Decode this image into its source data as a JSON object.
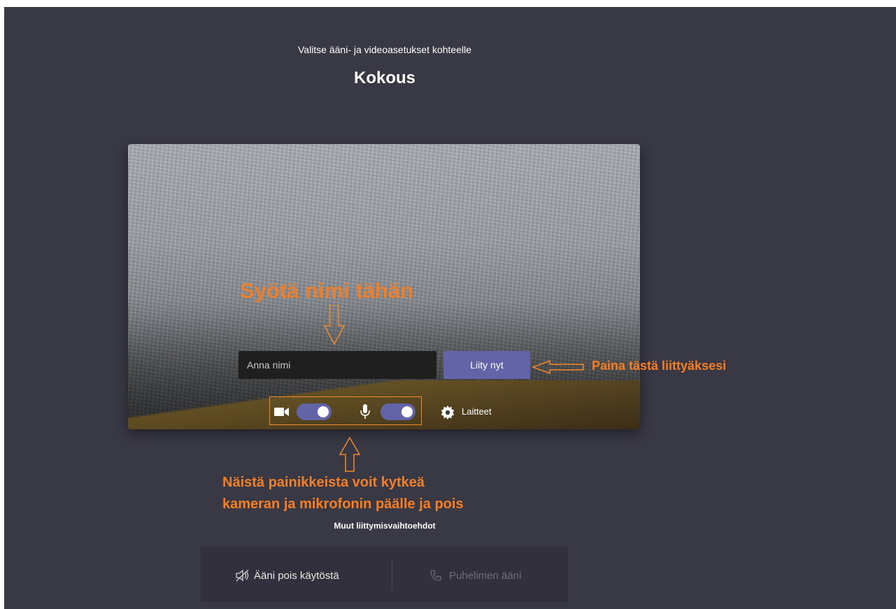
{
  "header": {
    "subtitle": "Valitse ääni- ja videoasetukset kohteelle",
    "title": "Kokous"
  },
  "preview": {
    "name_placeholder": "Anna nimi",
    "join_label": "Liity nyt",
    "camera_on": true,
    "mic_on": true,
    "devices_label": "Laitteet"
  },
  "annotations": {
    "name_hint": "Syötä nimi tähän",
    "join_hint": "Paina tästä liittyäksesi",
    "toggles_hint_line1": "Näistä painikkeista voit kytkeä",
    "toggles_hint_line2": "kameran ja mikrofonin päälle ja pois"
  },
  "options": {
    "title": "Muut liittymisvaihtoehdot",
    "audio_off_label": "Ääni pois käytöstä",
    "phone_audio_label": "Puhelimen ääni"
  },
  "colors": {
    "background": "#393845",
    "accent": "#6264a7",
    "annotation": "#f47f26"
  },
  "icons": {
    "camera": "camera-icon",
    "microphone": "microphone-icon",
    "settings": "gear-icon",
    "speaker_off": "speaker-off-icon",
    "phone": "phone-icon"
  }
}
